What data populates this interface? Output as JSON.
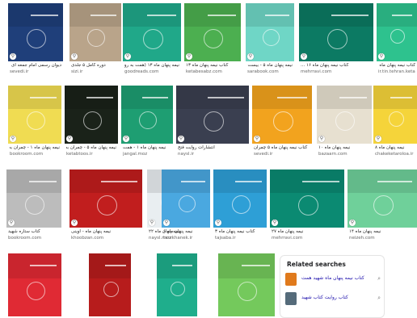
{
  "rows": [
    [
      {
        "caption": "دیوان رسمی امام جمعه ای ...",
        "source": "sevedi.ir",
        "color": "#1f3f7a"
      },
      {
        "caption": "دوره کامل ۵ جلدی",
        "source": "sizi.ir",
        "color": "#b9a48a"
      },
      {
        "caption": "نیمه پنهان ماه ۱۳ (همت به روایت همسر)",
        "source": "goodreads.com",
        "color": "#20a889"
      },
      {
        "caption": "کتاب نیمه پنهان ماه ۱۳",
        "source": "ketabesabz.com",
        "color": "#4caf50"
      },
      {
        "caption": "نیمه پنهان ماه ۵ - بیست و چهار ...",
        "source": "sarabook.com",
        "color": "#6fd6c6"
      },
      {
        "caption": "کتاب نیمه پنهان ماه ۱۶ ...",
        "source": "mehrravi.com",
        "color": "#0c7a63"
      },
      {
        "caption": "کتاب نیمه پنهان ماه ۱۴",
        "source": "ir.tin.tehran.ketab",
        "color": "#2ec28e"
      }
    ],
    [
      {
        "caption": "نیمه پنهان ماه ۱ - چمران به روایت",
        "source": "bookroom.com",
        "color": "#f0dc52"
      },
      {
        "caption": "نیمه پنهان ماه ۵ - چمران به روایت",
        "source": "ketabtoos.ir",
        "color": "#1a2219"
      },
      {
        "caption": "نیمه پنهان ماه ۱ - همت",
        "source": "jangal.moz",
        "color": "#1e9e72"
      },
      {
        "caption": "انتشارات روایت فتح",
        "source": "naysl.ir",
        "color": "#3a3f50"
      },
      {
        "caption": "کتاب نیمه پنهان ماه ۵ چمران",
        "source": "sevedi.ir",
        "color": "#f2a31e"
      },
      {
        "caption": "نیمه پنهان ماه ۱۰",
        "source": "bazaarn.com",
        "color": "#e7e0d0"
      },
      {
        "caption": "نیمه پنهان ماه ۸",
        "source": "chakeketaroloa.ir",
        "color": "#f5d43a"
      }
    ],
    [
      {
        "caption": "کتاب ستاره شهید",
        "source": "bookroom.com",
        "color": "#bcbcbc"
      },
      {
        "caption": "نیمه پنهان ماه - آوینی",
        "source": "khoobzan.com",
        "color": "#c11e1e"
      },
      {
        "caption": "نیمه پنهان ماه ۲۲",
        "source": "naysl.moz",
        "color": "#e9eef1"
      },
      {
        "caption": "نیمه پنهان ماه ۶",
        "source": "tarzkhanek.ir",
        "color": "#4aa8e0"
      },
      {
        "caption": "کتاب نیمه پنهان ماه ۳",
        "source": "tajsaba.ir",
        "color": "#2e9fd6"
      },
      {
        "caption": "نیمه پنهان ماه ۲۷",
        "source": "mehrravi.com",
        "color": "#0b8a72"
      },
      {
        "caption": "نیمه پنهان ماه ۱۴",
        "source": "neizeh.com",
        "color": "#6fd09a"
      }
    ],
    [
      {
        "caption": "",
        "source": "",
        "color": "#e02a34"
      },
      {
        "caption": "",
        "source": "",
        "color": "#b71c1c"
      },
      {
        "caption": "",
        "source": "",
        "color": "#1fae8c"
      },
      {
        "caption": "",
        "source": "",
        "color": "#74c95c"
      }
    ]
  ],
  "related": {
    "title": "Related searches",
    "items": [
      {
        "text": "کتاب نیمه پنهان ماه شهید همت",
        "color": "#e07a1c"
      },
      {
        "text": "کتاب روایت کتاب شهید",
        "color": "#556b7a"
      }
    ]
  }
}
